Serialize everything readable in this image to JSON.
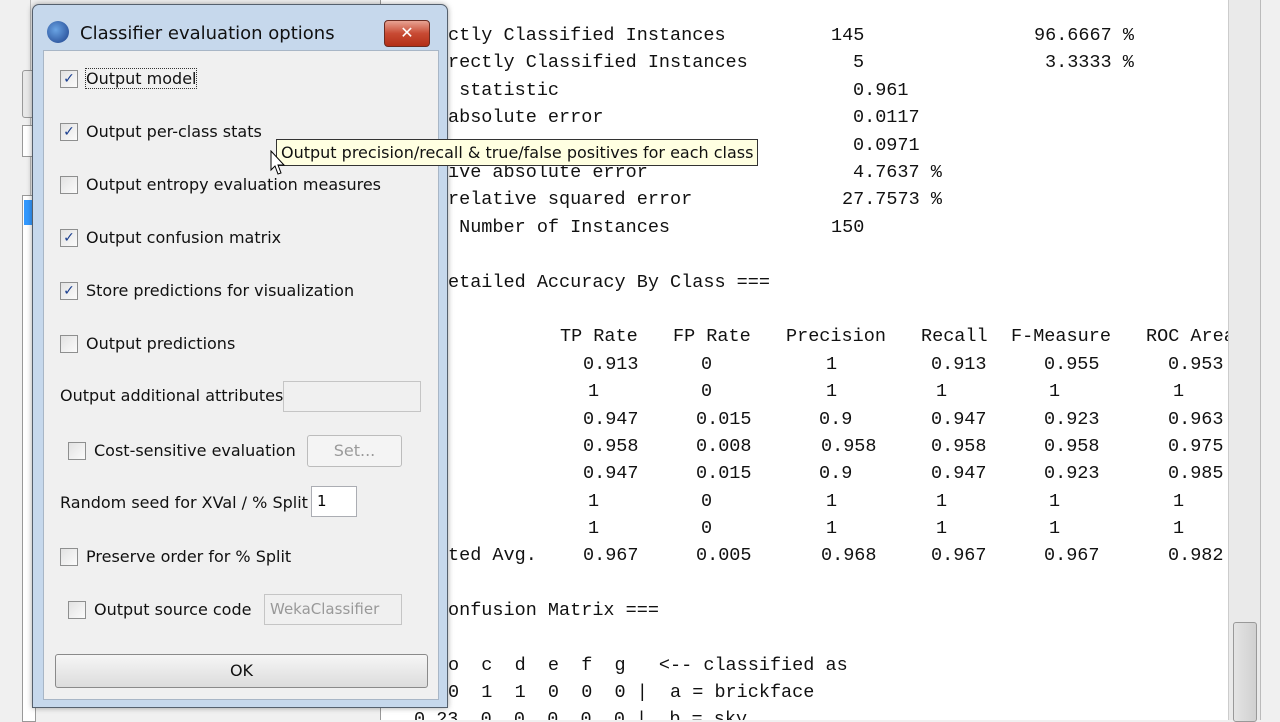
{
  "dialog": {
    "title": "Classifier evaluation options",
    "close_label": "✕",
    "options": [
      {
        "label": "Output model",
        "checked": true
      },
      {
        "label": "Output per-class stats",
        "checked": true
      },
      {
        "label": "Output entropy evaluation measures",
        "checked": false
      },
      {
        "label": "Output confusion matrix",
        "checked": true
      },
      {
        "label": "Store predictions for visualization",
        "checked": true
      },
      {
        "label": "Output predictions",
        "checked": false
      }
    ],
    "additional_attributes_label": "Output additional attributes",
    "additional_attributes_value": "",
    "cost_sensitive_label": "Cost-sensitive evaluation",
    "cost_sensitive_checked": false,
    "set_button": "Set...",
    "seed_label": "Random seed for XVal / % Split",
    "seed_value": "1",
    "preserve_order_label": "Preserve order for % Split",
    "preserve_order_checked": false,
    "source_code_label": "Output source code",
    "source_code_checked": false,
    "source_code_value": "WekaClassifier",
    "ok_button": "OK"
  },
  "tooltip": "Output precision/recall & true/false positives for each class",
  "output": {
    "summary": [
      [
        "ctly Classified Instances",
        "145",
        "96.6667 %"
      ],
      [
        "rectly Classified Instances",
        "5",
        "3.3333 %"
      ],
      [
        " statistic",
        "0.961",
        ""
      ],
      [
        "absolute error",
        "0.0117",
        ""
      ],
      [
        "",
        "0.0971",
        ""
      ],
      [
        "ive absolute error",
        "4.7637 %",
        ""
      ],
      [
        "relative squared error",
        "27.7573 %",
        ""
      ],
      [
        " Number of Instances",
        "150",
        ""
      ]
    ],
    "accuracy_title": "etailed Accuracy By Class ===",
    "accuracy_headers": [
      "TP Rate",
      "FP Rate",
      "Precision",
      "Recall",
      "F-Measure",
      "ROC Area"
    ],
    "accuracy_rows": [
      [
        "",
        "0.913",
        "0",
        "1",
        "0.913",
        "0.955",
        "0.953"
      ],
      [
        "",
        "1",
        "0",
        "1",
        "1",
        "1",
        "1"
      ],
      [
        "",
        "0.947",
        "0.015",
        "0.9",
        "0.947",
        "0.923",
        "0.963"
      ],
      [
        "",
        "0.958",
        "0.008",
        "0.958",
        "0.958",
        "0.958",
        "0.975"
      ],
      [
        "",
        "0.947",
        "0.015",
        "0.9",
        "0.947",
        "0.923",
        "0.985"
      ],
      [
        "",
        "1",
        "0",
        "1",
        "1",
        "1",
        "1"
      ],
      [
        "",
        "1",
        "0",
        "1",
        "1",
        "1",
        "1"
      ],
      [
        "ted Avg.",
        "0.967",
        "0.005",
        "0.968",
        "0.967",
        "0.967",
        "0.982"
      ]
    ],
    "confusion_title": "onfusion Matrix ===",
    "confusion_lines": [
      "o  c  d  e  f  g   <-- classified as",
      "0  1  1  0  0  0 |  a = brickface",
      "0 23  0  0  0  0  0 |  b = sky"
    ]
  }
}
